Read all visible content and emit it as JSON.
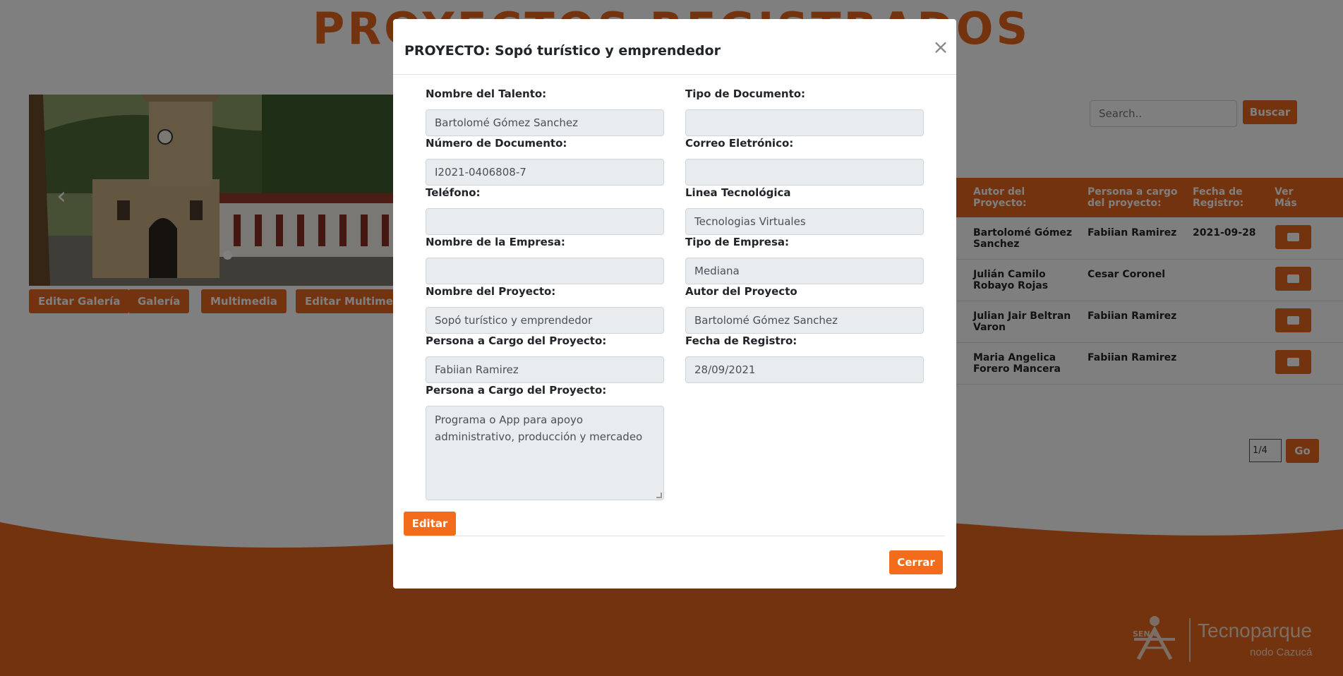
{
  "page": {
    "title": "PROYECTOS REGISTRADOS",
    "gallery_buttons": [
      "Editar Galería",
      "Galería",
      "Multimedia",
      "Editar Multimedia"
    ],
    "search": {
      "placeholder": "Search..",
      "button": "Buscar"
    },
    "table": {
      "headers": [
        "Autor del Proyecto:",
        "Persona a cargo del proyecto:",
        "Fecha de Registro:",
        "Ver Más"
      ],
      "rows": [
        {
          "autor": "Bartolomé Gómez Sanchez",
          "persona": "Fabiian Ramirez",
          "fecha": "2021-09-28"
        },
        {
          "autor": "Julián Camilo Robayo Rojas",
          "persona": "Cesar Coronel",
          "fecha": ""
        },
        {
          "autor": "Julian Jair Beltran Varon",
          "persona": "Fabiian Ramirez",
          "fecha": ""
        },
        {
          "autor": "Maria Angelica Forero Mancera",
          "persona": "Fabiian Ramirez",
          "fecha": ""
        }
      ]
    },
    "pagination": {
      "value": "1/4",
      "button": "Go"
    },
    "footer": {
      "brand": "Tecnoparque",
      "sub": "nodo  Cazucá",
      "sena": "SENA"
    }
  },
  "modal": {
    "title": "PROYECTO: Sopó turístico y emprendedor",
    "close_symbol": "×",
    "fields": {
      "talento_label": "Nombre del Talento:",
      "talento_value": "Bartolomé Gómez Sanchez",
      "tipo_doc_label": "Tipo de Documento:",
      "tipo_doc_value": "",
      "num_doc_label": "Número de Documento:",
      "num_doc_value": "I2021-0406808-7",
      "correo_label": "Correo Eletrónico:",
      "correo_value": "",
      "telefono_label": "Teléfono:",
      "telefono_value": "",
      "linea_label": "Linea Tecnológica",
      "linea_value": "Tecnologias Virtuales",
      "empresa_label": "Nombre de la Empresa:",
      "empresa_value": "",
      "tipo_empresa_label": "Tipo de Empresa:",
      "tipo_empresa_value": "Mediana",
      "proyecto_label": "Nombre del Proyecto:",
      "proyecto_value": "Sopó turístico y emprendedor",
      "autor_label": "Autor del Proyecto",
      "autor_value": "Bartolomé Gómez Sanchez",
      "persona_label": "Persona a Cargo del Proyecto:",
      "persona_value": "Fabiian Ramirez",
      "fecha_label": "Fecha de Registro:",
      "fecha_value": "28/09/2021",
      "descripcion_label": "Persona a Cargo del Proyecto:",
      "descripcion_value": "Programa o App para apoyo administrativo, producción y mercadeo"
    },
    "edit_button": "Editar",
    "close_button": "Cerrar"
  },
  "colors": {
    "accent": "#e8671f",
    "button": "#f26c1c",
    "wave": "#b5521a"
  }
}
